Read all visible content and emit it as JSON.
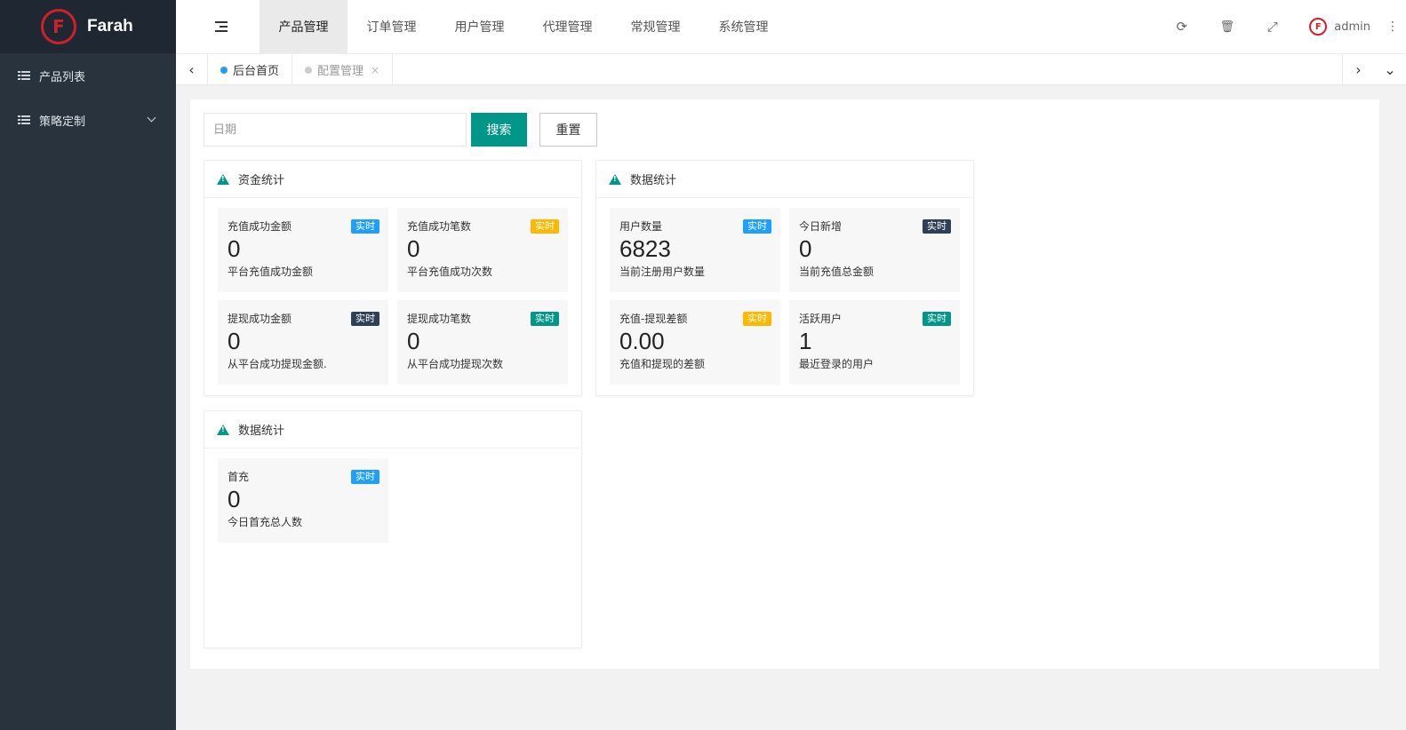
{
  "app": {
    "brand": "Farah",
    "logo_letter": "F"
  },
  "sidebar": {
    "items": [
      {
        "label": "产品列表",
        "icon": "list-icon"
      },
      {
        "label": "策略定制",
        "icon": "list-icon",
        "expandable": true
      }
    ]
  },
  "header": {
    "tabs": [
      {
        "label": "产品管理",
        "active": true
      },
      {
        "label": "订单管理"
      },
      {
        "label": "用户管理"
      },
      {
        "label": "代理管理"
      },
      {
        "label": "常规管理"
      },
      {
        "label": "系统管理"
      }
    ],
    "tools": {
      "refresh": "⟳",
      "trash": "🗑",
      "fullscreen": "⤢",
      "more": "⋮"
    },
    "user": {
      "name": "admin",
      "avatar_letter": "F"
    }
  },
  "tabstrip": {
    "tabs": [
      {
        "label": "后台首页",
        "active": true
      },
      {
        "label": "配置管理",
        "closable": true
      }
    ],
    "close_glyph": "×",
    "left_arrow": "‹",
    "right_arrow": "›",
    "down_arrow": "⌄"
  },
  "search": {
    "placeholder": "日期",
    "search_label": "搜索",
    "reset_label": "重置"
  },
  "colors": {
    "accent": "#009688",
    "blue": "#1e9fff",
    "orange": "#ffb800",
    "dark": "#2f4056",
    "sidebar": "#28333e"
  },
  "cards": [
    {
      "title": "资金统计",
      "stats": [
        {
          "label": "充值成功金额",
          "value": "0",
          "desc": "平台充值成功金额",
          "badge": "实时",
          "badge_color": "#1e9fff"
        },
        {
          "label": "充值成功笔数",
          "value": "0",
          "desc": "平台充值成功次数",
          "badge": "实时",
          "badge_color": "#ffb800"
        },
        {
          "label": "提现成功金额",
          "value": "0",
          "desc": "从平台成功提现金额.",
          "badge": "实时",
          "badge_color": "#2f4056"
        },
        {
          "label": "提现成功笔数",
          "value": "0",
          "desc": "从平台成功提现次数",
          "badge": "实时",
          "badge_color": "#009688"
        }
      ]
    },
    {
      "title": "数据统计",
      "stats": [
        {
          "label": "用户数量",
          "value": "6823",
          "desc": "当前注册用户数量",
          "badge": "实时",
          "badge_color": "#1e9fff"
        },
        {
          "label": "今日新增",
          "value": "0",
          "desc": "当前充值总金额",
          "badge": "实时",
          "badge_color": "#2f4056"
        },
        {
          "label": "充值-提现差额",
          "value": "0.00",
          "desc": "充值和提现的差额",
          "badge": "实时",
          "badge_color": "#ffb800"
        },
        {
          "label": "活跃用户",
          "value": "1",
          "desc": "最近登录的用户",
          "badge": "实时",
          "badge_color": "#009688"
        }
      ]
    },
    {
      "title": "数据统计",
      "stats": [
        {
          "label": "首充",
          "value": "0",
          "desc": "今日首充总人数",
          "badge": "实时",
          "badge_color": "#1e9fff"
        }
      ]
    }
  ]
}
